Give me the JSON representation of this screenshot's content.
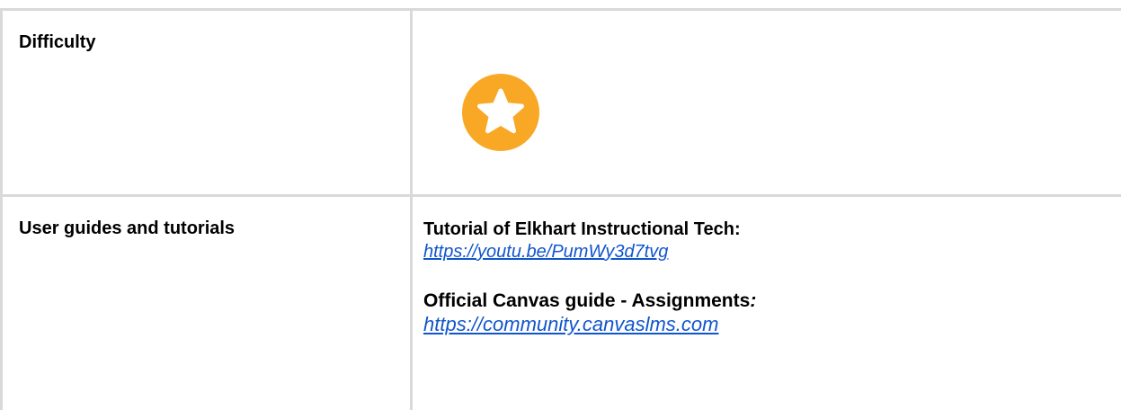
{
  "rows": [
    {
      "label": "Difficulty",
      "rating_stars": 1
    },
    {
      "label": "User guides and tutorials",
      "resources": [
        {
          "heading": "Tutorial of Elkhart Instructional Tech:",
          "link": "https://youtu.be/PumWy3d7tvg"
        },
        {
          "heading": "Official Canvas guide - Assignments",
          "heading_suffix": ":",
          "link": "https://community.canvaslms.com"
        }
      ]
    }
  ],
  "colors": {
    "star_fill": "#f9a825",
    "link": "#1155cc",
    "border": "#d9d9d9"
  },
  "icons": {
    "difficulty": "star-circle-icon"
  }
}
